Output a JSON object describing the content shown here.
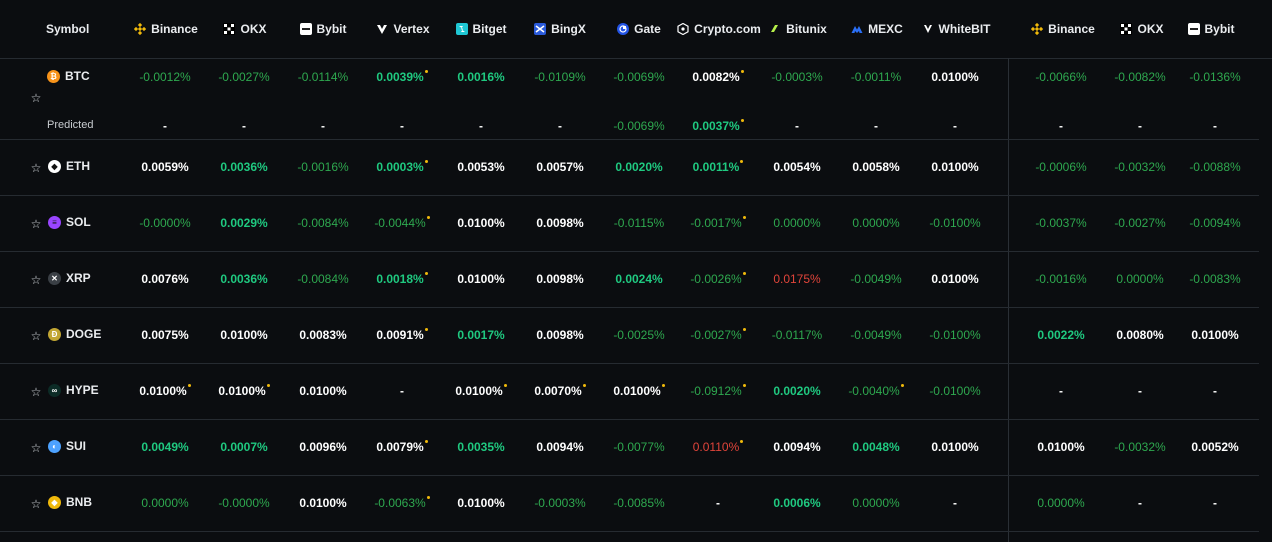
{
  "header": {
    "symbol": "Symbol",
    "exchanges": [
      {
        "name": "Binance",
        "icon": "binance-icon",
        "color": "#f0b90b"
      },
      {
        "name": "OKX",
        "icon": "okx-icon",
        "color": "#ffffff"
      },
      {
        "name": "Bybit",
        "icon": "bybit-icon",
        "color": "#ffffff"
      },
      {
        "name": "Vertex",
        "icon": "vertex-icon",
        "color": "#ffffff"
      },
      {
        "name": "Bitget",
        "icon": "bitget-icon",
        "color": "#1fc7d4"
      },
      {
        "name": "BingX",
        "icon": "bingx-icon",
        "color": "#2a5ada"
      },
      {
        "name": "Gate",
        "icon": "gate-icon",
        "color": "#2354e6"
      },
      {
        "name": "Crypto.com",
        "icon": "cryptocom-icon",
        "color": "#ffffff"
      },
      {
        "name": "Bitunix",
        "icon": "bitunix-icon",
        "color": "#b7f04a"
      },
      {
        "name": "MEXC",
        "icon": "mexc-icon",
        "color": "#2a6ff6"
      },
      {
        "name": "WhiteBIT",
        "icon": "whitebit-icon",
        "color": "#ffffff"
      },
      {
        "name": "Binance",
        "icon": "binance-icon",
        "color": "#f0b90b"
      },
      {
        "name": "OKX",
        "icon": "okx-icon",
        "color": "#ffffff"
      },
      {
        "name": "Bybit",
        "icon": "bybit-icon",
        "color": "#ffffff"
      }
    ]
  },
  "predicted_label": "Predicted",
  "rows": [
    {
      "symbol": "BTC",
      "icon": "btc-icon",
      "icon_color": "#f7931a",
      "values": [
        [
          "-0.0012%",
          "g",
          0
        ],
        [
          "-0.0027%",
          "g",
          0
        ],
        [
          "-0.0114%",
          "g",
          0
        ],
        [
          "0.0039%",
          "gb",
          1
        ],
        [
          "0.0016%",
          "gb",
          0
        ],
        [
          "-0.0109%",
          "g",
          0
        ],
        [
          "-0.0069%",
          "g",
          0
        ],
        [
          "0.0082%",
          "w",
          1
        ],
        [
          "-0.0003%",
          "g",
          0
        ],
        [
          "-0.0011%",
          "g",
          0
        ],
        [
          "0.0100%",
          "w",
          0
        ],
        [
          "-0.0066%",
          "g",
          0
        ],
        [
          "-0.0082%",
          "g",
          0
        ],
        [
          "-0.0136%",
          "g",
          0
        ]
      ],
      "predicted": [
        [
          "-",
          "d",
          0
        ],
        [
          "-",
          "d",
          0
        ],
        [
          "-",
          "d",
          0
        ],
        [
          "-",
          "d",
          0
        ],
        [
          "-",
          "d",
          0
        ],
        [
          "-",
          "d",
          0
        ],
        [
          "-0.0069%",
          "g",
          0
        ],
        [
          "0.0037%",
          "gb",
          1
        ],
        [
          "-",
          "d",
          0
        ],
        [
          "-",
          "d",
          0
        ],
        [
          "-",
          "d",
          0
        ],
        [
          "-",
          "d",
          0
        ],
        [
          "-",
          "d",
          0
        ],
        [
          "-",
          "d",
          0
        ]
      ]
    },
    {
      "symbol": "ETH",
      "icon": "eth-icon",
      "icon_color": "#ffffff",
      "values": [
        [
          "0.0059%",
          "w",
          0
        ],
        [
          "0.0036%",
          "gb",
          0
        ],
        [
          "-0.0016%",
          "g",
          0
        ],
        [
          "0.0003%",
          "gb",
          1
        ],
        [
          "0.0053%",
          "w",
          0
        ],
        [
          "0.0057%",
          "w",
          0
        ],
        [
          "0.0020%",
          "gb",
          0
        ],
        [
          "0.0011%",
          "gb",
          1
        ],
        [
          "0.0054%",
          "w",
          0
        ],
        [
          "0.0058%",
          "w",
          0
        ],
        [
          "0.0100%",
          "w",
          0
        ],
        [
          "-0.0006%",
          "g",
          0
        ],
        [
          "-0.0032%",
          "g",
          0
        ],
        [
          "-0.0088%",
          "g",
          0
        ]
      ]
    },
    {
      "symbol": "SOL",
      "icon": "sol-icon",
      "icon_color": "#9945ff",
      "values": [
        [
          "-0.0000%",
          "g",
          0
        ],
        [
          "0.0029%",
          "gb",
          0
        ],
        [
          "-0.0084%",
          "g",
          0
        ],
        [
          "-0.0044%",
          "g",
          1
        ],
        [
          "0.0100%",
          "w",
          0
        ],
        [
          "0.0098%",
          "w",
          0
        ],
        [
          "-0.0115%",
          "g",
          0
        ],
        [
          "-0.0017%",
          "g",
          1
        ],
        [
          "0.0000%",
          "g",
          0
        ],
        [
          "0.0000%",
          "g",
          0
        ],
        [
          "-0.0100%",
          "g",
          0
        ],
        [
          "-0.0037%",
          "g",
          0
        ],
        [
          "-0.0027%",
          "g",
          0
        ],
        [
          "-0.0094%",
          "g",
          0
        ]
      ]
    },
    {
      "symbol": "XRP",
      "icon": "xrp-icon",
      "icon_color": "#3a3f45",
      "values": [
        [
          "0.0076%",
          "w",
          0
        ],
        [
          "0.0036%",
          "gb",
          0
        ],
        [
          "-0.0084%",
          "g",
          0
        ],
        [
          "0.0018%",
          "gb",
          1
        ],
        [
          "0.0100%",
          "w",
          0
        ],
        [
          "0.0098%",
          "w",
          0
        ],
        [
          "0.0024%",
          "gb",
          0
        ],
        [
          "-0.0026%",
          "g",
          1
        ],
        [
          "0.0175%",
          "r",
          0
        ],
        [
          "-0.0049%",
          "g",
          0
        ],
        [
          "0.0100%",
          "w",
          0
        ],
        [
          "-0.0016%",
          "g",
          0
        ],
        [
          "0.0000%",
          "g",
          0
        ],
        [
          "-0.0083%",
          "g",
          0
        ]
      ]
    },
    {
      "symbol": "DOGE",
      "icon": "doge-icon",
      "icon_color": "#c2a633",
      "values": [
        [
          "0.0075%",
          "w",
          0
        ],
        [
          "0.0100%",
          "w",
          0
        ],
        [
          "0.0083%",
          "w",
          0
        ],
        [
          "0.0091%",
          "w",
          1
        ],
        [
          "0.0017%",
          "gb",
          0
        ],
        [
          "0.0098%",
          "w",
          0
        ],
        [
          "-0.0025%",
          "g",
          0
        ],
        [
          "-0.0027%",
          "g",
          1
        ],
        [
          "-0.0117%",
          "g",
          0
        ],
        [
          "-0.0049%",
          "g",
          0
        ],
        [
          "-0.0100%",
          "g",
          0
        ],
        [
          "0.0022%",
          "gb",
          0
        ],
        [
          "0.0080%",
          "w",
          0
        ],
        [
          "0.0100%",
          "w",
          0
        ]
      ]
    },
    {
      "symbol": "HYPE",
      "icon": "hype-icon",
      "icon_color": "#0c2b26",
      "values": [
        [
          "0.0100%",
          "w",
          1
        ],
        [
          "0.0100%",
          "w",
          1
        ],
        [
          "0.0100%",
          "w",
          0
        ],
        [
          "-",
          "d",
          0
        ],
        [
          "0.0100%",
          "w",
          1
        ],
        [
          "0.0070%",
          "w",
          1
        ],
        [
          "0.0100%",
          "w",
          1
        ],
        [
          "-0.0912%",
          "g",
          1
        ],
        [
          "0.0020%",
          "gb",
          0
        ],
        [
          "-0.0040%",
          "g",
          1
        ],
        [
          "-0.0100%",
          "g",
          0
        ],
        [
          "-",
          "d",
          0
        ],
        [
          "-",
          "d",
          0
        ],
        [
          "-",
          "d",
          0
        ]
      ]
    },
    {
      "symbol": "SUI",
      "icon": "sui-icon",
      "icon_color": "#4da2ff",
      "values": [
        [
          "0.0049%",
          "gb",
          0
        ],
        [
          "0.0007%",
          "gb",
          0
        ],
        [
          "0.0096%",
          "w",
          0
        ],
        [
          "0.0079%",
          "w",
          1
        ],
        [
          "0.0035%",
          "gb",
          0
        ],
        [
          "0.0094%",
          "w",
          0
        ],
        [
          "-0.0077%",
          "g",
          0
        ],
        [
          "0.0110%",
          "r",
          1
        ],
        [
          "0.0094%",
          "w",
          0
        ],
        [
          "0.0048%",
          "gb",
          0
        ],
        [
          "0.0100%",
          "w",
          0
        ],
        [
          "0.0100%",
          "w",
          0
        ],
        [
          "-0.0032%",
          "g",
          0
        ],
        [
          "0.0052%",
          "w",
          0
        ]
      ]
    },
    {
      "symbol": "BNB",
      "icon": "bnb-icon",
      "icon_color": "#f0b90b",
      "values": [
        [
          "0.0000%",
          "g",
          0
        ],
        [
          "-0.0000%",
          "g",
          0
        ],
        [
          "0.0100%",
          "w",
          0
        ],
        [
          "-0.0063%",
          "g",
          1
        ],
        [
          "0.0100%",
          "w",
          0
        ],
        [
          "-0.0003%",
          "g",
          0
        ],
        [
          "-0.0085%",
          "g",
          0
        ],
        [
          "-",
          "d",
          0
        ],
        [
          "0.0006%",
          "gb",
          0
        ],
        [
          "0.0000%",
          "g",
          0
        ],
        [
          "-",
          "d",
          0
        ],
        [
          "0.0000%",
          "g",
          0
        ],
        [
          "-",
          "d",
          0
        ],
        [
          "-",
          "d",
          0
        ]
      ]
    }
  ]
}
